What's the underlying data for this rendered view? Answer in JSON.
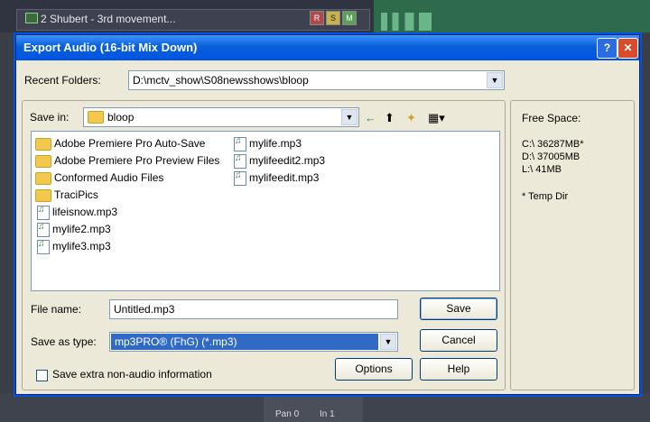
{
  "background": {
    "track_label": "2 Shubert - 3rd movement...",
    "track_buttons": [
      "R",
      "S",
      "M"
    ],
    "mixer_labels": [
      "Pan 0",
      "In 1"
    ]
  },
  "dialog": {
    "title": "Export Audio (16-bit Mix Down)",
    "recent_folders_label": "Recent Folders:",
    "recent_folders_value": "D:\\mctv_show\\S08newsshows\\bloop",
    "save_in_label": "Save in:",
    "save_in_value": "bloop",
    "files": [
      {
        "name": "Adobe Premiere Pro Auto-Save",
        "type": "folder"
      },
      {
        "name": "Adobe Premiere Pro Preview Files",
        "type": "folder"
      },
      {
        "name": "Conformed Audio Files",
        "type": "folder"
      },
      {
        "name": "TraciPics",
        "type": "folder"
      },
      {
        "name": "lifeisnow.mp3",
        "type": "audio"
      },
      {
        "name": "mylife2.mp3",
        "type": "audio"
      },
      {
        "name": "mylife3.mp3",
        "type": "audio"
      },
      {
        "name": "mylife.mp3",
        "type": "audio"
      },
      {
        "name": "mylifeedit2.mp3",
        "type": "audio"
      },
      {
        "name": "mylifeedit.mp3",
        "type": "audio"
      }
    ],
    "file_name_label": "File name:",
    "file_name_value": "Untitled.mp3",
    "save_as_type_label": "Save as type:",
    "save_as_type_value": "mp3PRO® (FhG) (*.mp3)",
    "save_button": "Save",
    "cancel_button": "Cancel",
    "options_button": "Options",
    "help_button": "Help",
    "extra_info_label": "Save extra non-audio information",
    "extra_info_checked": false,
    "free_space_title": "Free Space:",
    "drives": [
      "C:\\  36287MB*",
      "D:\\  37005MB",
      "L:\\  41MB"
    ],
    "temp_note": "* Temp Dir"
  }
}
